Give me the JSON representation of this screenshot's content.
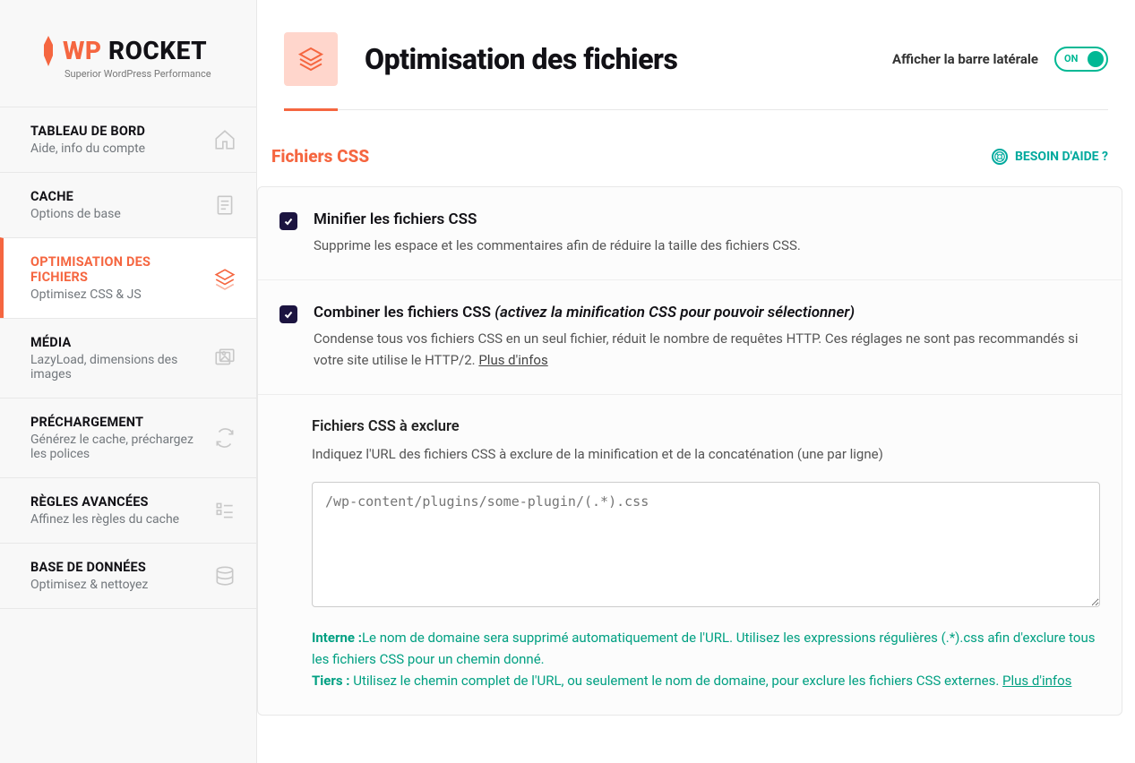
{
  "brand": {
    "wp": "WP",
    "rocket": " ROCKET",
    "tagline": "Superior WordPress Performance"
  },
  "nav": {
    "items": [
      {
        "title": "TABLEAU DE BORD",
        "sub": "Aide, info du compte"
      },
      {
        "title": "CACHE",
        "sub": "Options de base"
      },
      {
        "title": "OPTIMISATION DES FICHIERS",
        "sub": "Optimisez CSS & JS"
      },
      {
        "title": "MÉDIA",
        "sub": "LazyLoad, dimensions des images"
      },
      {
        "title": "PRÉCHARGEMENT",
        "sub": "Générez le cache, préchargez les polices"
      },
      {
        "title": "RÈGLES AVANCÉES",
        "sub": "Affinez les règles du cache"
      },
      {
        "title": "BASE DE DONNÉES",
        "sub": "Optimisez & nettoyez"
      }
    ]
  },
  "header": {
    "title": "Optimisation des fichiers",
    "toggle_label": "Afficher la barre latérale",
    "toggle_state": "ON"
  },
  "section": {
    "title": "Fichiers CSS",
    "help": "BESOIN D'AIDE ?"
  },
  "options": {
    "minify": {
      "title": "Minifier les fichiers CSS",
      "desc": "Supprime les espace et les commentaires afin de réduire la taille des fichiers CSS."
    },
    "combine": {
      "title": "Combiner les fichiers CSS ",
      "title_ital": "(activez la minification CSS pour pouvoir sélectionner)",
      "desc": "Condense tous vos fichiers CSS en un seul fichier, réduit le nombre de requêtes HTTP. Ces réglages ne sont pas recommandés si votre site utilise le HTTP/2. ",
      "more": "Plus d'infos"
    },
    "exclude": {
      "title": "Fichiers CSS à exclure",
      "desc": "Indiquez l'URL des fichiers CSS à exclure de la minification et de la concaténation (une par ligne)",
      "placeholder": "/wp-content/plugins/some-plugin/(.*).css",
      "hint_interne_label": "Interne :",
      "hint_interne": "Le nom de domaine sera supprimé automatiquement de l'URL. Utilisez les expressions régulières (.*).css afin d'exclure tous les fichiers CSS pour un chemin donné.",
      "hint_tiers_label": "Tiers :",
      "hint_tiers": " Utilisez le chemin complet de l'URL, ou seulement le nom de domaine, pour exclure les fichiers CSS externes. ",
      "hint_more": "Plus d'infos"
    }
  }
}
